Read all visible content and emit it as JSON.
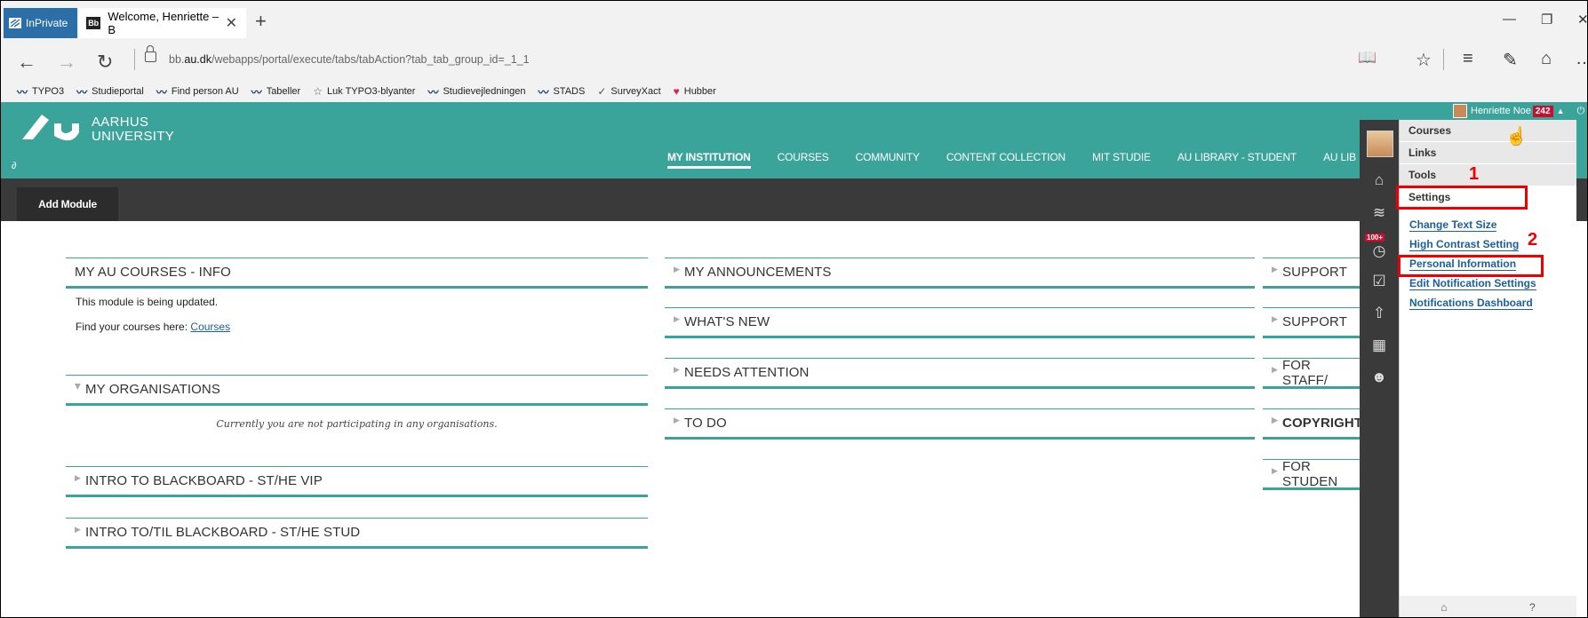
{
  "browser": {
    "inprivate_label": "InPrivate",
    "tab_title": "Welcome, Henriette – B",
    "tab_icon": "Bb",
    "url_prefix": "bb.",
    "url_domain": "au.dk",
    "url_rest": "/webapps/portal/execute/tabs/tabAction?tab_tab_group_id=_1_1"
  },
  "favorites": [
    {
      "label": "TYPO3",
      "icon": "au-wave-icon"
    },
    {
      "label": "Studieportal",
      "icon": "au-wave-icon"
    },
    {
      "label": "Find person AU",
      "icon": "au-wave-icon"
    },
    {
      "label": "Tabeller",
      "icon": "au-wave-icon"
    },
    {
      "label": "Luk TYPO3-blyanter",
      "icon": "star-icon"
    },
    {
      "label": "Studievejledningen",
      "icon": "au-wave-icon"
    },
    {
      "label": "STADS",
      "icon": "au-wave-icon"
    },
    {
      "label": "SurveyXact",
      "icon": "check-icon"
    },
    {
      "label": "Hubber",
      "icon": "hubber-icon"
    }
  ],
  "site": {
    "logo_line1": "AARHUS",
    "logo_line2": "UNIVERSITY",
    "user_name": "Henriette Noe",
    "user_badge": "242",
    "nav": [
      "MY INSTITUTION",
      "COURSES",
      "COMMUNITY",
      "CONTENT COLLECTION",
      "MIT STUDIE",
      "AU LIBRARY - STUDENT",
      "AU LIB"
    ],
    "add_module": "Add Module"
  },
  "modules": {
    "col1": {
      "m1_title": "MY AU COURSES - INFO",
      "m1_line1": "This module is being updated.",
      "m1_line2": "Find your courses here: ",
      "m1_link": "Courses",
      "m2_title": "MY ORGANISATIONS",
      "m2_text": "Currently you are not participating in any organisations.",
      "m3_title": "INTRO TO BLACKBOARD - ST/HE VIP",
      "m4_title": "INTRO TO/TIL BLACKBOARD - ST/HE STUD"
    },
    "col2": [
      "MY ANNOUNCEMENTS",
      "WHAT'S NEW",
      "NEEDS ATTENTION",
      "TO DO"
    ],
    "col3": [
      "SUPPORT",
      "SUPPORT",
      "FOR STAFF/",
      "COPYRIGHT",
      "FOR STUDEN"
    ]
  },
  "rail": {
    "badge": "100+"
  },
  "menu": {
    "items": [
      "Courses",
      "Links",
      "Tools",
      "Settings"
    ],
    "settings": [
      "Change Text Size",
      "High Contrast Setting",
      "Personal Information",
      "Edit Notification Settings",
      "Notifications Dashboard"
    ],
    "footer_left": "⌂",
    "footer_right": "?"
  },
  "annotations": {
    "n1": "1",
    "n2": "2",
    "color": "#e00000"
  },
  "colors": {
    "header_teal": "#3aa39a",
    "module_bar": "#3a3a3a",
    "link_blue": "#1a5fa0"
  }
}
